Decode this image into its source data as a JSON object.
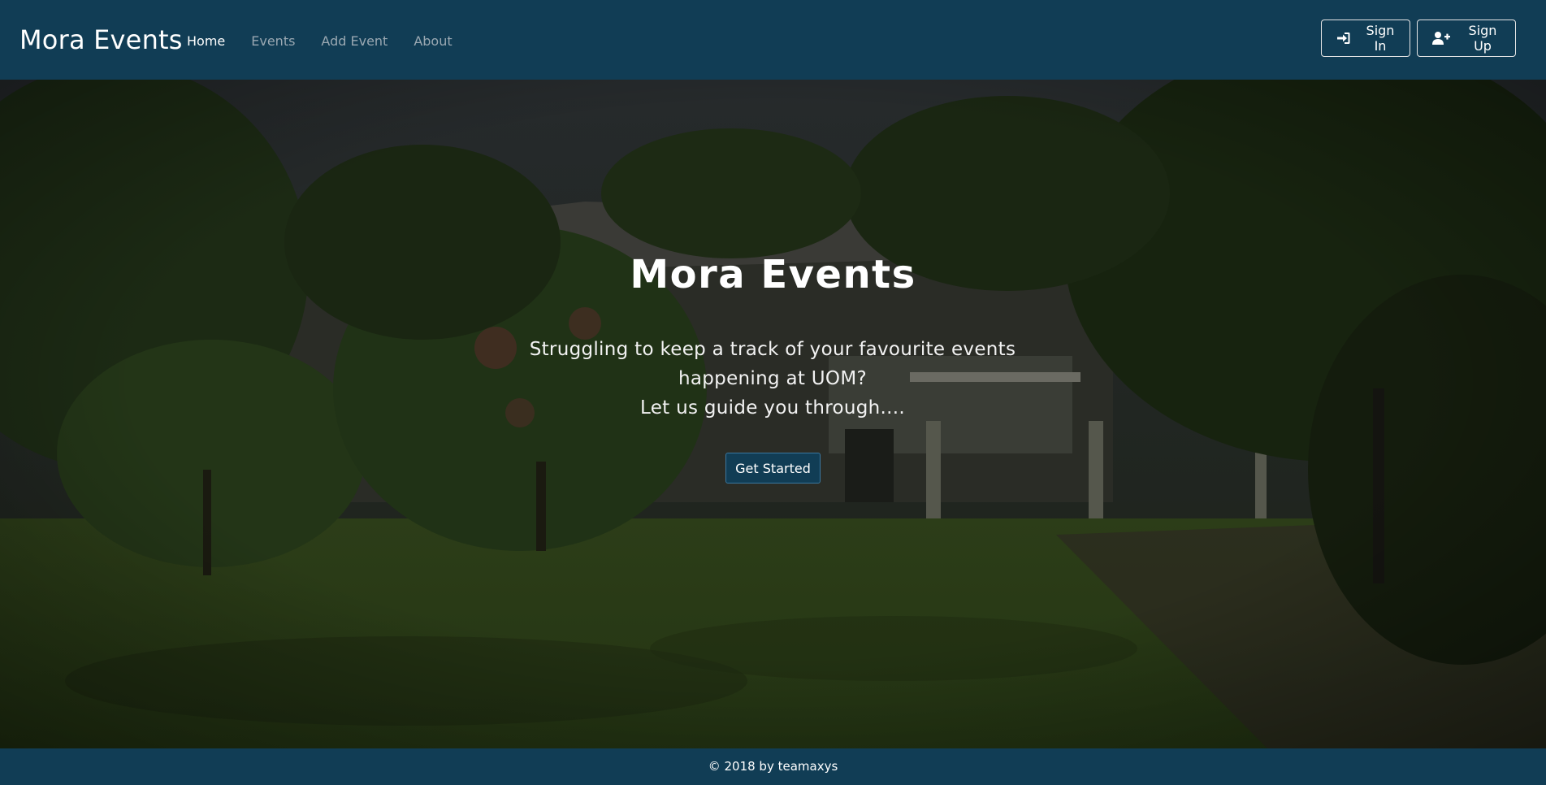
{
  "nav": {
    "brand": "Mora Events",
    "links": [
      {
        "label": "Home",
        "active": true
      },
      {
        "label": "Events",
        "active": false
      },
      {
        "label": "Add Event",
        "active": false
      },
      {
        "label": "About",
        "active": false
      }
    ],
    "signin_label": "Sign In",
    "signup_label": "Sign Up",
    "signin_icon": "sign-in-icon",
    "signup_icon": "user-plus-icon"
  },
  "hero": {
    "title": "Mora Events",
    "line1": "Struggling to keep a track of your favourite events happening at UOM?",
    "line2": "Let us guide you through....",
    "cta_label": "Get Started"
  },
  "footer": {
    "text": "© 2018 by teamaxys"
  },
  "colors": {
    "navbar": "#113d55",
    "footer": "#113d55",
    "text": "#ffffff",
    "muted_link": "#9aa8b2"
  }
}
